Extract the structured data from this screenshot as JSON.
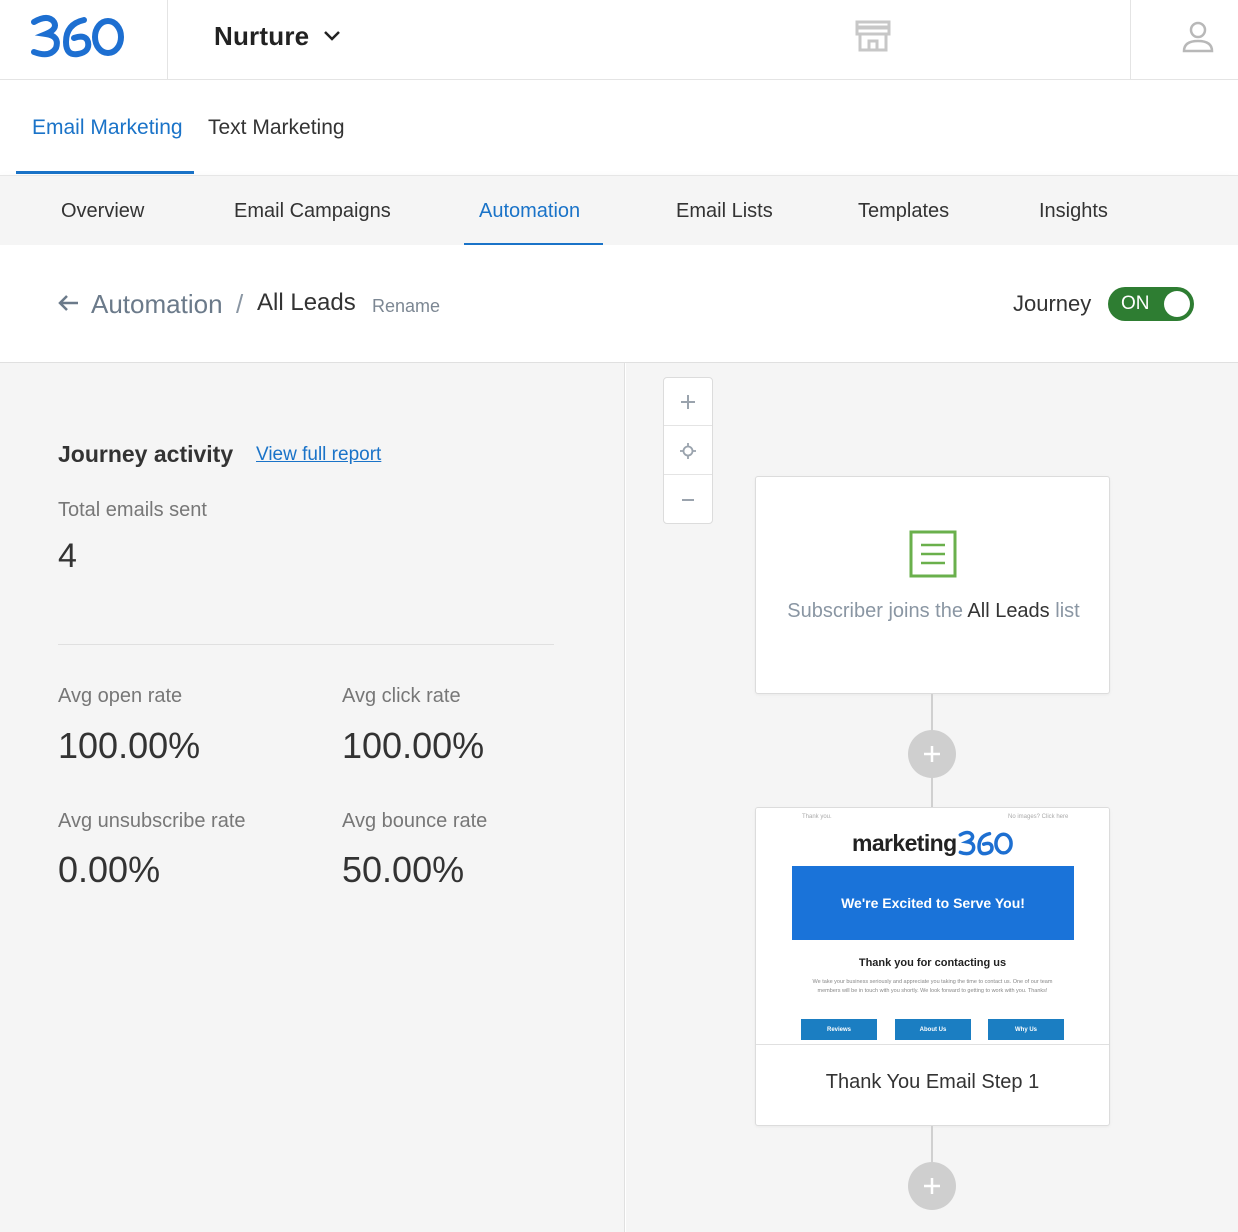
{
  "topbar": {
    "app_name": "Nurture",
    "icons": {
      "logo": "360-logo",
      "switch": "chevron-down-icon",
      "store": "store-icon",
      "user": "user-icon"
    }
  },
  "primary_tabs": [
    {
      "label": "Email Marketing",
      "active": true
    },
    {
      "label": "Text Marketing",
      "active": false
    }
  ],
  "secondary_nav": [
    {
      "label": "Overview",
      "active": false
    },
    {
      "label": "Email Campaigns",
      "active": false
    },
    {
      "label": "Automation",
      "active": true
    },
    {
      "label": "Email Lists",
      "active": false
    },
    {
      "label": "Templates",
      "active": false
    },
    {
      "label": "Insights",
      "active": false
    }
  ],
  "breadcrumb": {
    "parent": "Automation",
    "separator": "/",
    "current": "All Leads",
    "rename": "Rename"
  },
  "journey": {
    "label": "Journey",
    "toggle_text": "ON",
    "enabled": true,
    "toggle_color": "#2e7d32"
  },
  "activity": {
    "title": "Journey activity",
    "report_link": "View full report",
    "total_label": "Total emails sent",
    "total_value": "4",
    "stats": {
      "open": {
        "label": "Avg open rate",
        "value": "100.00%"
      },
      "click": {
        "label": "Avg click rate",
        "value": "100.00%"
      },
      "unsubscribe": {
        "label": "Avg unsubscribe rate",
        "value": "0.00%"
      },
      "bounce": {
        "label": "Avg bounce rate",
        "value": "50.00%"
      }
    }
  },
  "canvas": {
    "zoom": {
      "in": "zoom-in-icon",
      "center": "recenter-icon",
      "out": "zoom-out-icon"
    },
    "trigger": {
      "text_prefix": "Subscriber joins the",
      "list_name": "All Leads",
      "text_suffix": "list",
      "icon": "list-document-icon",
      "icon_color": "#6ab04c"
    },
    "email_step": {
      "title": "Thank You Email Step 1",
      "preview": {
        "top_left": "Thank you.",
        "top_right": "No images? Click here",
        "brand": "marketing",
        "banner": "We're Excited to Serve You!",
        "heading": "Thank you for contacting us",
        "body": "We take your business seriously and appreciate you taking the time to contact us. One of our team members will be in touch with you shortly. We look forward to getting to work with you. Thanks!",
        "buttons": [
          "Reviews",
          "About Us",
          "Why Us"
        ]
      }
    }
  },
  "colors": {
    "accent": "#1a73c8",
    "on_green": "#2e7d32",
    "panel_bg": "#f5f5f5"
  }
}
